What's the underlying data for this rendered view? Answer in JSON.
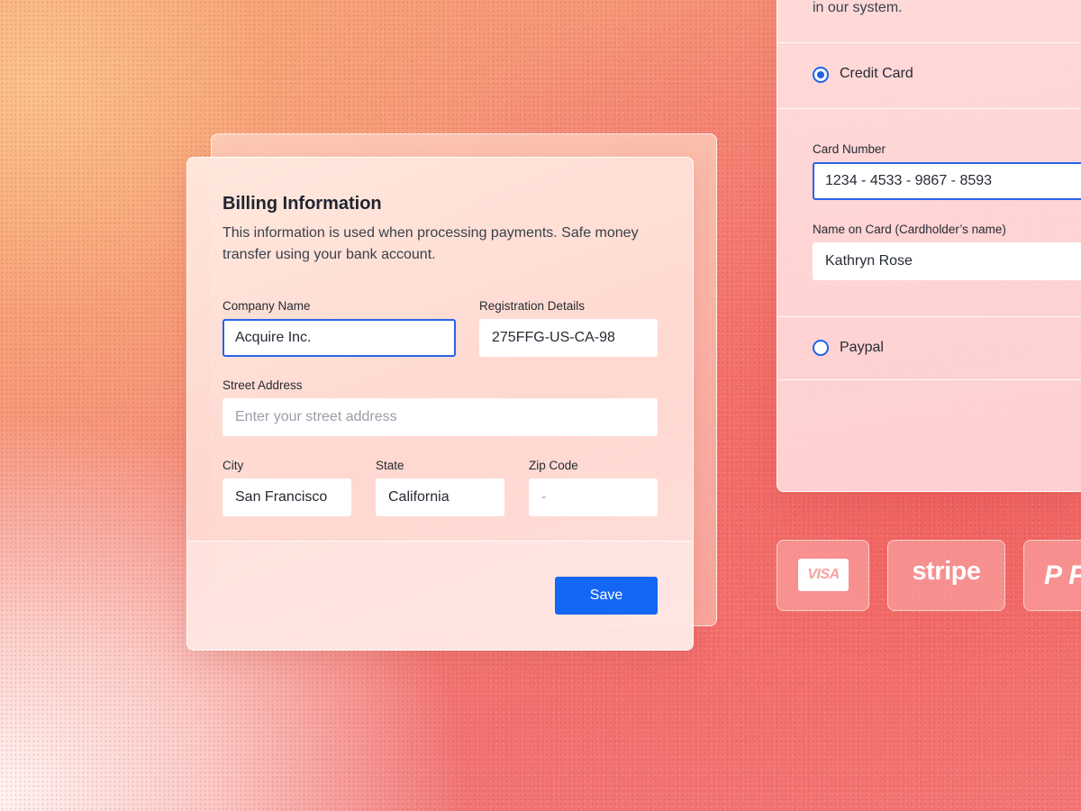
{
  "billing": {
    "title": "Billing Information",
    "description": "This information is used when processing payments. Safe money transfer using your bank account.",
    "company_name": {
      "label": "Company Name",
      "value": "Acquire Inc."
    },
    "registration": {
      "label": "Registration Details",
      "value": "275FFG-US-CA-98"
    },
    "street": {
      "label": "Street Address",
      "value": "",
      "placeholder": "Enter your street address"
    },
    "city": {
      "label": "City",
      "value": "San Francisco"
    },
    "state": {
      "label": "State",
      "value": "California"
    },
    "zip": {
      "label": "Zip Code",
      "value": "",
      "placeholder": "-"
    },
    "save_label": "Save"
  },
  "payment": {
    "intro": "in our system.",
    "credit_card": {
      "label": "Credit Card",
      "checked": true
    },
    "card_number": {
      "label": "Card Number",
      "value": "1234 - 4533 - 9867 - 8593"
    },
    "card_name": {
      "label": "Name on Card (Cardholder’s name)",
      "value": "Kathryn Rose"
    },
    "paypal": {
      "label": "Paypal",
      "checked": false
    }
  },
  "logos": {
    "visa": "VISA",
    "stripe": "stripe",
    "paypal": "P P"
  },
  "colors": {
    "accent": "#1466f5",
    "focus_border": "#2a63e6"
  }
}
